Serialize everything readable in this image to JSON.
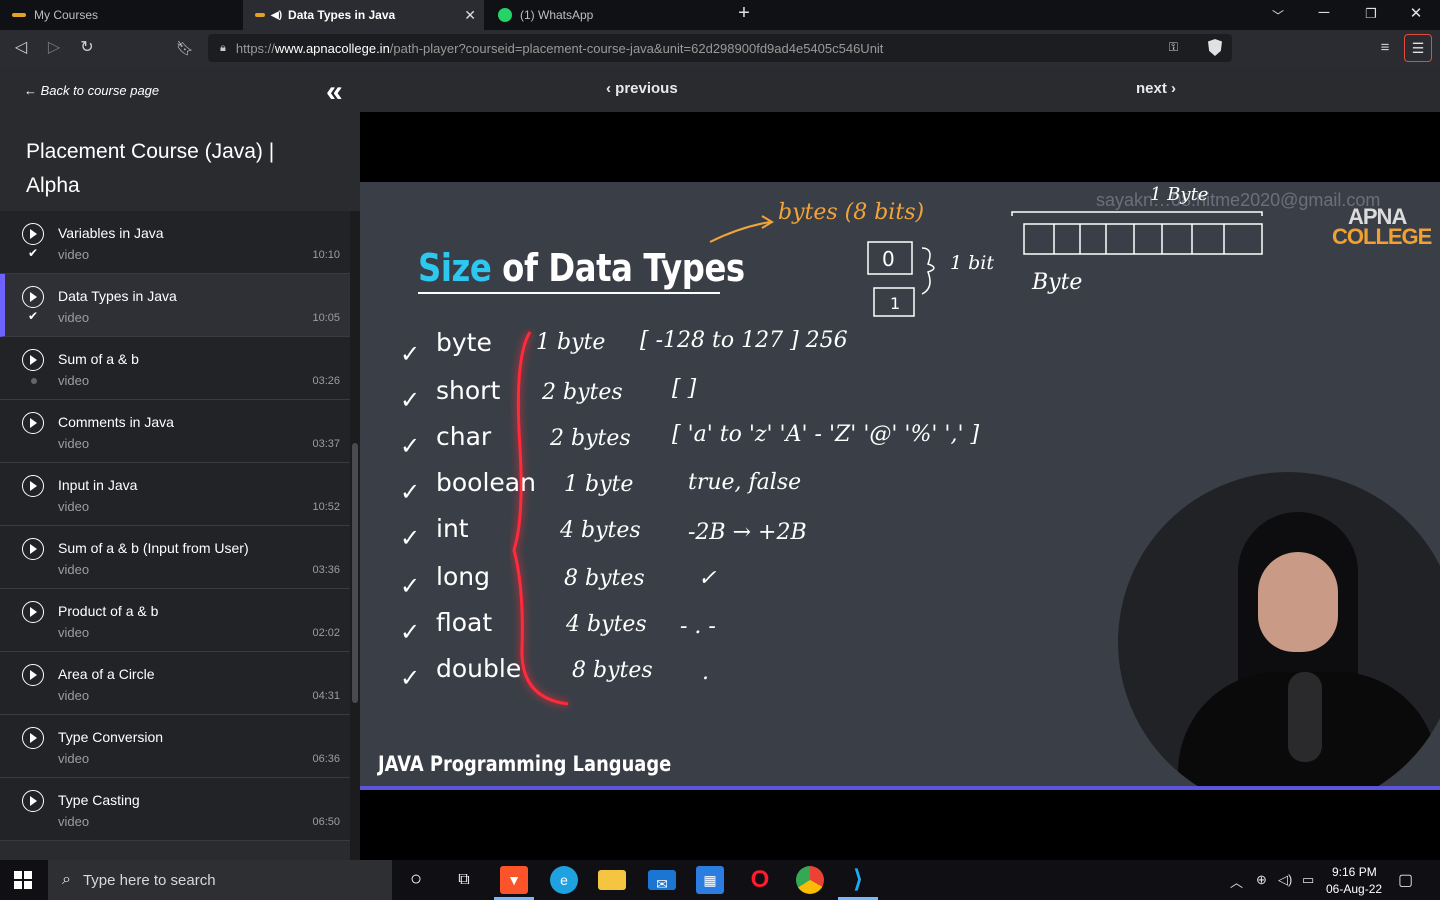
{
  "browser": {
    "tabs": [
      {
        "label": "My Courses",
        "active": false
      },
      {
        "label": "Data Types in Java",
        "active": true
      },
      {
        "label": "(1) WhatsApp",
        "active": false
      }
    ],
    "new_tab": "+",
    "url_prefix": "https://",
    "url_domain": "www.apnacollege.in",
    "url_path": "/path-player?courseid=placement-course-java&unit=62d298900fd9ad4e5405c546Unit"
  },
  "sidebar": {
    "back_label": "← Back to course page",
    "course_title": "Placement Course (Java) | Alpha",
    "lessons": [
      {
        "title": "Variables in Java",
        "type": "video",
        "duration": "10:10",
        "status": "done"
      },
      {
        "title": "Data Types in Java",
        "type": "video",
        "duration": "10:05",
        "status": "done"
      },
      {
        "title": "Sum of a & b",
        "type": "video",
        "duration": "03:26",
        "status": "pending"
      },
      {
        "title": "Comments in Java",
        "type": "video",
        "duration": "03:37",
        "status": "none"
      },
      {
        "title": "Input in Java",
        "type": "video",
        "duration": "10:52",
        "status": "none"
      },
      {
        "title": "Sum of a & b (Input from User)",
        "type": "video",
        "duration": "03:36",
        "status": "none"
      },
      {
        "title": "Product of a & b",
        "type": "video",
        "duration": "02:02",
        "status": "none"
      },
      {
        "title": "Area of a Circle",
        "type": "video",
        "duration": "04:31",
        "status": "none"
      },
      {
        "title": "Type Conversion",
        "type": "video",
        "duration": "06:36",
        "status": "none"
      },
      {
        "title": "Type Casting",
        "type": "video",
        "duration": "06:50",
        "status": "none"
      }
    ]
  },
  "nav": {
    "previous": "‹ previous",
    "next": "next ›"
  },
  "slide": {
    "title_highlight": "Size",
    "title_rest": " of Data Types",
    "watermark": "sayakn…08.hitme2020@gmail.com",
    "logo_top": "APNA",
    "logo_bottom": "COLLEGE",
    "annot_bytes": "bytes (8 bits)",
    "annot_onebyte": "1 Byte",
    "annot_bit": "1 bit",
    "annot_byte": "Byte",
    "types": [
      {
        "name": "byte",
        "size": "1 byte",
        "range": "[ -128 to 127 ]  256"
      },
      {
        "name": "short",
        "size": "2 bytes",
        "range": "[                 ]"
      },
      {
        "name": "char",
        "size": "2 bytes",
        "range": "[ 'a' to 'z'  'A' - 'Z'  '@'  '%'  ',' ]"
      },
      {
        "name": "boolean",
        "size": "1 byte",
        "range": "true, false"
      },
      {
        "name": "int",
        "size": "4 bytes",
        "range": "-2B → +2B"
      },
      {
        "name": "long",
        "size": "8 bytes",
        "range": "✓"
      },
      {
        "name": "float",
        "size": "4 bytes",
        "range": "- . -"
      },
      {
        "name": "double",
        "size": "8 bytes",
        "range": "."
      }
    ],
    "footer": "JAVA Programming Language"
  },
  "taskbar": {
    "search_placeholder": "Type here to search",
    "time": "9:16 PM",
    "date": "06-Aug-22"
  },
  "colors": {
    "accent": "#6f63ff",
    "title_cyan": "#2dc7f0",
    "annotation_orange": "#f2a43a",
    "brace_red": "#ff2a3a"
  }
}
